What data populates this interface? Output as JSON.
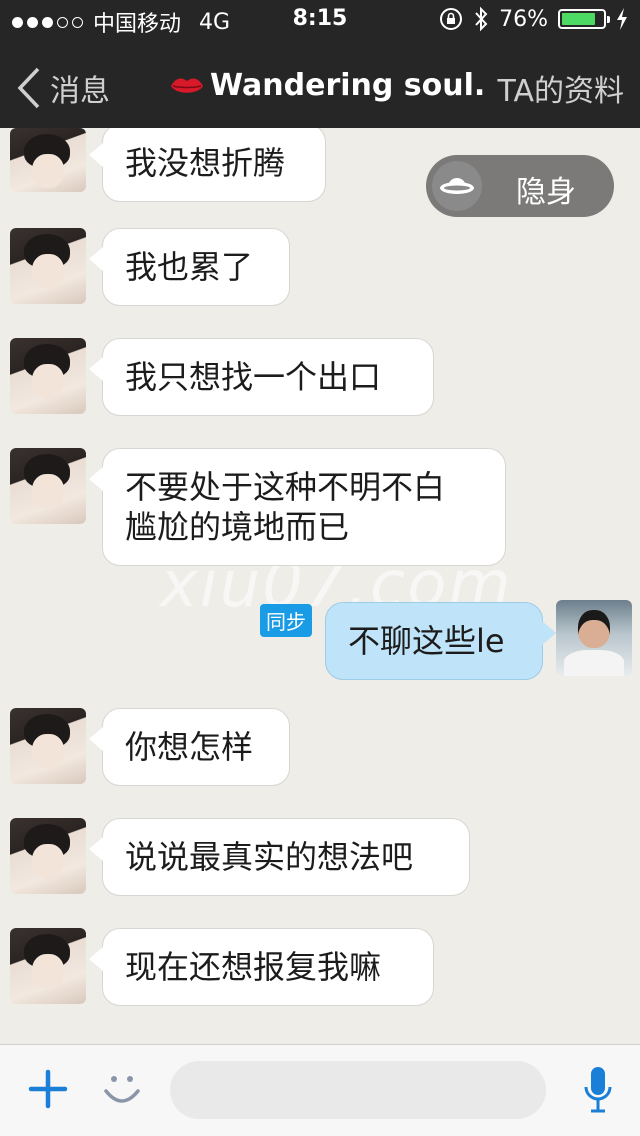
{
  "status_bar": {
    "carrier": "中国移动",
    "network": "4G",
    "time": "8:15",
    "battery": "76%",
    "signal_bars_filled": 3,
    "signal_bars_total": 5
  },
  "nav": {
    "back_label": "消息",
    "title": "Wandering soul.",
    "right_label": "TA的资料"
  },
  "stealth_button": {
    "label": "隐身"
  },
  "watermark": "xiu07.com",
  "messages": [
    {
      "side": "left",
      "text": "我没想折腾"
    },
    {
      "side": "left",
      "text": "我也累了"
    },
    {
      "side": "left",
      "text": "我只想找一个出口"
    },
    {
      "side": "left",
      "text_lines": [
        "不要处于这种不明不白",
        "尴尬的境地而已"
      ]
    },
    {
      "side": "right",
      "text": "不聊这些le",
      "tag": "同步"
    },
    {
      "side": "left",
      "text": "你想怎样"
    },
    {
      "side": "left",
      "text": "说说最真实的想法吧"
    },
    {
      "side": "left",
      "text": "现在还想报复我嘛"
    }
  ],
  "input_bar": {
    "placeholder": ""
  },
  "colors": {
    "nav_bg": "#262626",
    "chat_bg": "#efede8",
    "sent_bubble": "#bfe3f8",
    "accent": "#1a9be6",
    "battery_fill": "#4cd964"
  }
}
